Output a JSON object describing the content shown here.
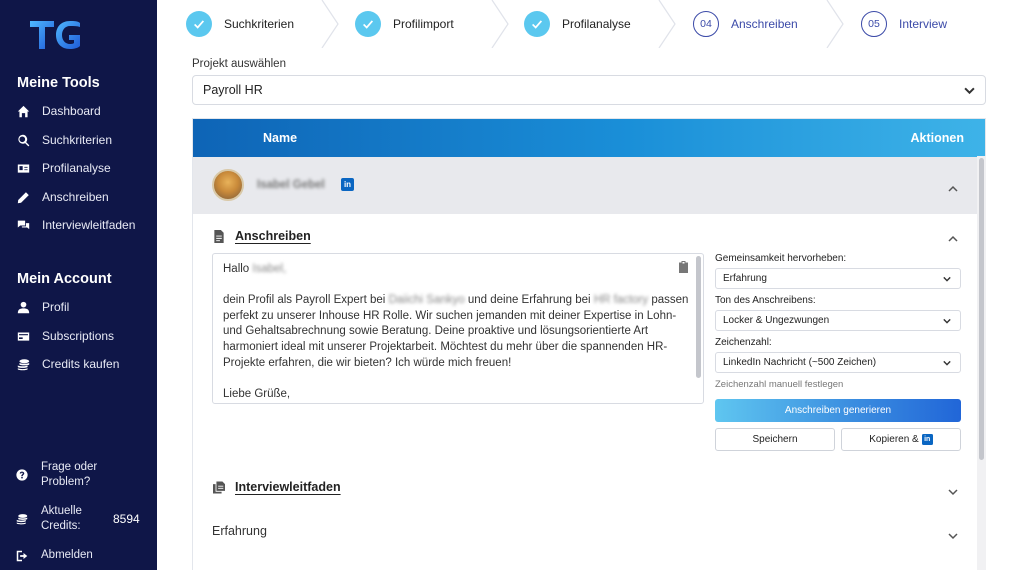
{
  "sidebar": {
    "logo_text": "TG",
    "tools_heading": "Meine Tools",
    "tools": [
      {
        "label": "Dashboard",
        "icon": "home-icon"
      },
      {
        "label": "Suchkriterien",
        "icon": "search-icon"
      },
      {
        "label": "Profilanalyse",
        "icon": "id-card-icon"
      },
      {
        "label": "Anschreiben",
        "icon": "pencil-icon"
      },
      {
        "label": "Interviewleitfaden",
        "icon": "chat-icon"
      }
    ],
    "account_heading": "Mein Account",
    "account": [
      {
        "label": "Profil",
        "icon": "user-icon"
      },
      {
        "label": "Subscriptions",
        "icon": "card-icon"
      },
      {
        "label": "Credits kaufen",
        "icon": "coins-icon"
      }
    ],
    "help_line1": "Frage oder",
    "help_line2": "Problem?",
    "credits_line1": "Aktuelle",
    "credits_line2": "Credits:",
    "credits_value": "8594",
    "logout": "Abmelden"
  },
  "stepper": {
    "steps": [
      {
        "label": "Suchkriterien",
        "state": "done"
      },
      {
        "label": "Profilimport",
        "state": "done"
      },
      {
        "label": "Profilanalyse",
        "state": "done"
      },
      {
        "label": "Anschreiben",
        "number": "04",
        "state": "active"
      },
      {
        "label": "Interview",
        "number": "05",
        "state": "active"
      }
    ]
  },
  "project": {
    "label": "Projekt auswählen",
    "value": "Payroll HR"
  },
  "table": {
    "col_name": "Name",
    "col_actions": "Aktionen",
    "person_name": "Isabel Gebel",
    "linkedin_badge": "in"
  },
  "letter_section": {
    "title": "Anschreiben",
    "greeting": "Hallo",
    "greeting_name": "Isabel,",
    "body_1": "dein Profil als Payroll Expert bei",
    "company_1": "Daiichi Sankyo",
    "body_2": "und deine Erfahrung bei",
    "company_2": "HR factory",
    "body_3": "passen perfekt zu unserer Inhouse HR Rolle. Wir suchen jemanden mit deiner Expertise in Lohn- und Gehaltsabrechnung sowie Beratung. Deine proaktive und lösungsorientierte Art harmoniert ideal mit unserer Projektarbeit. Möchtest du mehr über die spannenden HR-Projekte erfahren, die wir bieten? Ich würde mich freuen!",
    "closing": "Liebe Grüße,"
  },
  "options": {
    "common_label": "Gemeinsamkeit hervorheben:",
    "common_value": "Erfahrung",
    "tone_label": "Ton des Anschreibens:",
    "tone_value": "Locker & Ungezwungen",
    "chars_label": "Zeichenzahl:",
    "chars_value": "LinkedIn Nachricht (~500 Zeichen)",
    "chars_hint": "Zeichenzahl manuell festlegen",
    "generate_button": "Anschreiben generieren",
    "save_button": "Speichern",
    "copy_button": "Kopieren &",
    "copy_badge": "in"
  },
  "sections": {
    "interview": "Interviewleitfaden",
    "experience": "Erfahrung"
  },
  "colors": {
    "sidebar_bg": "#0f1648",
    "accent": "#5bc8ef",
    "active_step": "#3b4aa8",
    "linkedin": "#0a66c2"
  }
}
